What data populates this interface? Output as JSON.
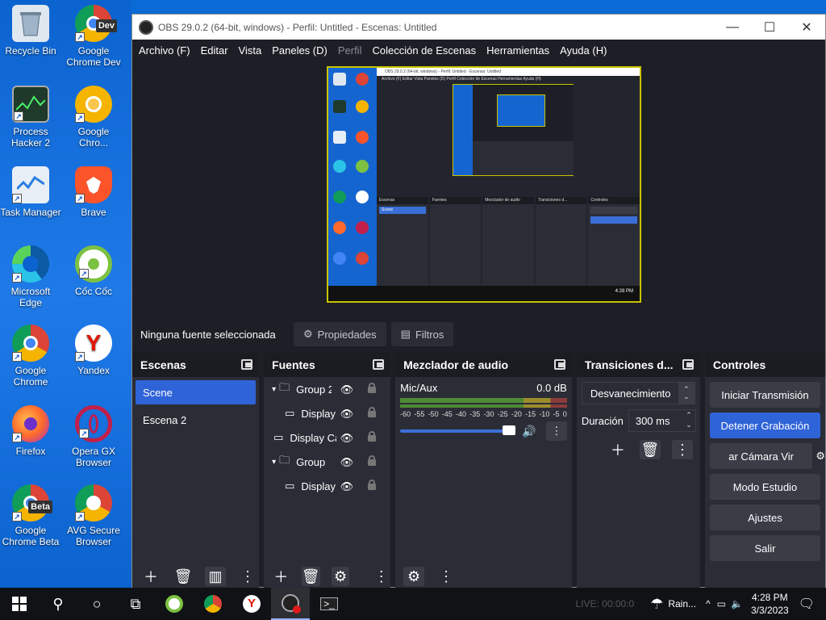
{
  "desktop": {
    "icons": [
      {
        "label": "Recycle Bin",
        "name": "recycle-bin"
      },
      {
        "label": "Google Chrome Dev",
        "name": "chrome-dev",
        "badge": "Dev"
      },
      {
        "label": "Process Hacker 2",
        "name": "process-hacker"
      },
      {
        "label": "Google Chro...",
        "name": "chrome-canary"
      },
      {
        "label": "Task Manager",
        "name": "task-manager"
      },
      {
        "label": "Brave",
        "name": "brave"
      },
      {
        "label": "Microsoft Edge",
        "name": "edge"
      },
      {
        "label": "Cốc Cốc",
        "name": "coccoc"
      },
      {
        "label": "Google Chrome",
        "name": "chrome"
      },
      {
        "label": "Yandex",
        "name": "yandex"
      },
      {
        "label": "Firefox",
        "name": "firefox"
      },
      {
        "label": "Opera GX Browser",
        "name": "opera-gx"
      },
      {
        "label": "Google Chrome Beta",
        "name": "chrome-beta",
        "badge": "Beta"
      },
      {
        "label": "AVG Secure Browser",
        "name": "avg-browser"
      }
    ]
  },
  "window": {
    "title": "OBS 29.0.2 (64-bit, windows) - Perfil: Untitled - Escenas: Untitled",
    "minimize": "—",
    "maximize": "☐",
    "close": "✕"
  },
  "menu": {
    "items": [
      "Archivo (F)",
      "Editar",
      "Vista",
      "Paneles (D)",
      "Perfil",
      "Colección de Escenas",
      "Herramientas",
      "Ayuda (H)"
    ]
  },
  "preview": {
    "title": "OBS 29.0.2 (64-bit, windows) - Perfil: Untitled - Escenas: Untitled",
    "menu": "Archivo (F)  Editar  Vista  Paneles (D)  Perfil  Colección de Escenas  Herramientas  Ayuda (H)",
    "docks": [
      {
        "title": "Escenas",
        "selected": "Scene"
      },
      {
        "title": "Fuentes",
        "selected": ""
      },
      {
        "title": "Mezclador de audio",
        "selected": ""
      },
      {
        "title": "Transiciones d...",
        "selected": ""
      },
      {
        "title": "Controles",
        "selected": ""
      }
    ],
    "clock": "4:28 PM"
  },
  "source_toolbar": {
    "no_selection": "Ninguna fuente seleccionada",
    "properties": "Propiedades",
    "filters": "Filtros"
  },
  "scenes": {
    "title": "Escenas",
    "items": [
      {
        "label": "Scene",
        "selected": true
      },
      {
        "label": "Escena 2",
        "selected": false
      }
    ]
  },
  "sources": {
    "title": "Fuentes",
    "items": [
      {
        "label": "Group 2",
        "type": "group",
        "indent": 0
      },
      {
        "label": "Display",
        "type": "display",
        "indent": 1
      },
      {
        "label": "Display Capture",
        "type": "display",
        "indent": 0
      },
      {
        "label": "Group",
        "type": "group",
        "indent": 0
      },
      {
        "label": "Display",
        "type": "display",
        "indent": 1
      }
    ]
  },
  "mixer": {
    "title": "Mezclador de audio",
    "channel": "Mic/Aux",
    "level": "0.0 dB",
    "scale": [
      "-60",
      "-55",
      "-50",
      "-45",
      "-40",
      "-35",
      "-30",
      "-25",
      "-20",
      "-15",
      "-10",
      "-5",
      "0"
    ],
    "volume": 1.0
  },
  "transitions": {
    "title": "Transiciones d...",
    "selected": "Desvanecimiento",
    "duration_label": "Duración",
    "duration_value": "300 ms"
  },
  "controls": {
    "title": "Controles",
    "buttons": [
      {
        "label": "Iniciar Transmisión",
        "active": false
      },
      {
        "label": "Detener Grabación",
        "active": true
      },
      {
        "label": "ar Cámara Vir",
        "active": false
      },
      {
        "label": "Modo Estudio",
        "active": false
      },
      {
        "label": "Ajustes",
        "active": false
      },
      {
        "label": "Salir",
        "active": false
      }
    ]
  },
  "taskbar": {
    "status": "LIVE: 00:00:0",
    "weather": "Rain...",
    "time": "4:28 PM",
    "date": "3/3/2023"
  },
  "colors": {
    "accent": "#2f63d8",
    "dock_bg": "#2b2d36",
    "window_bg": "#1e1f26",
    "preview_border": "#c8c400"
  }
}
